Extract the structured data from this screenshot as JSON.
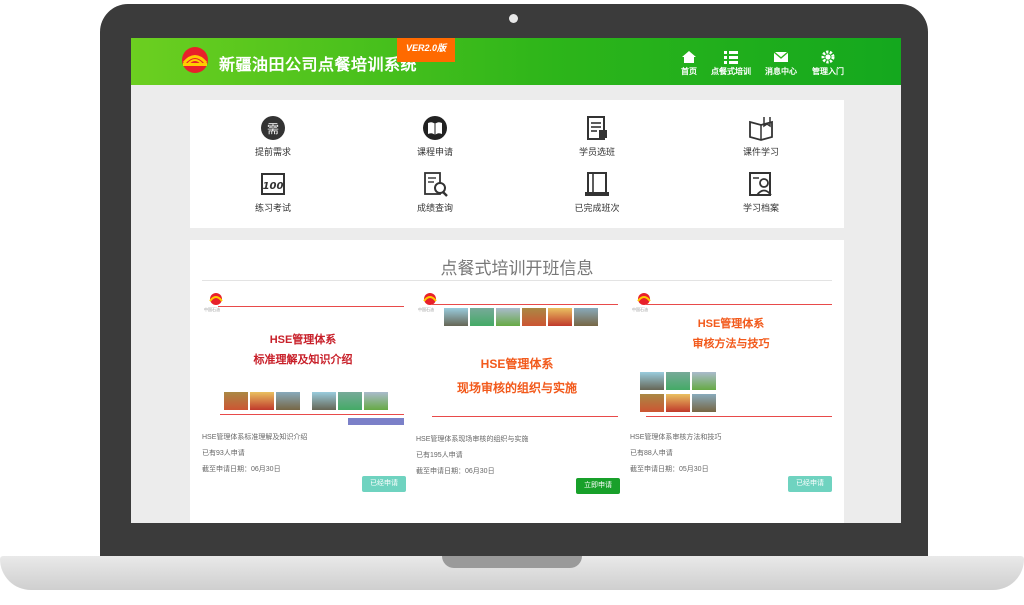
{
  "header": {
    "title": "新疆油田公司点餐培训系统",
    "version": "VER2.0版",
    "nav": [
      {
        "label": "首页",
        "icon": "home-icon"
      },
      {
        "label": "点餐式培训",
        "icon": "list-icon"
      },
      {
        "label": "消息中心",
        "icon": "mail-icon"
      },
      {
        "label": "管理入门",
        "icon": "gear-icon"
      }
    ]
  },
  "quick_links": [
    {
      "label": "提前需求",
      "icon": "need-icon"
    },
    {
      "label": "课程申请",
      "icon": "book-icon"
    },
    {
      "label": "学员选班",
      "icon": "class-select-icon"
    },
    {
      "label": "课件学习",
      "icon": "courseware-icon"
    },
    {
      "label": "练习考试",
      "icon": "exam-icon"
    },
    {
      "label": "成绩查询",
      "icon": "score-query-icon"
    },
    {
      "label": "已完成班次",
      "icon": "completed-icon"
    },
    {
      "label": "学习档案",
      "icon": "archive-icon"
    }
  ],
  "section": {
    "title": "点餐式培训开班信息"
  },
  "courses": [
    {
      "title_line1": "HSE管理体系",
      "title_line2": "标准理解及知识介绍",
      "name": "HSE管理体系标准理解及知识介绍",
      "applicants": "已有93人申请",
      "deadline": "截至申请日期：06月30日",
      "button": "已经申请",
      "button_color": "#6fd3c0",
      "logo_text": "中国石油"
    },
    {
      "title_line1": "HSE管理体系",
      "title_line2": "现场审核的组织与实施",
      "name": "HSE管理体系现场审核的组织与实施",
      "applicants": "已有195人申请",
      "deadline": "截至申请日期：06月30日",
      "button": "立即申请",
      "button_color": "#18a02a",
      "logo_text": "中国石油"
    },
    {
      "title_line1": "HSE管理体系",
      "title_line2": "审核方法与技巧",
      "name": "HSE管理体系审核方法和技巧",
      "applicants": "已有88人申请",
      "deadline": "截至申请日期：05月30日",
      "button": "已经申请",
      "button_color": "#6fd3c0",
      "logo_text": "中国石油"
    }
  ],
  "colors": {
    "brand_green": "#2db51a",
    "version_orange": "#ff6a00",
    "title_red": "#c8202a",
    "title_orange": "#f25a1c"
  }
}
